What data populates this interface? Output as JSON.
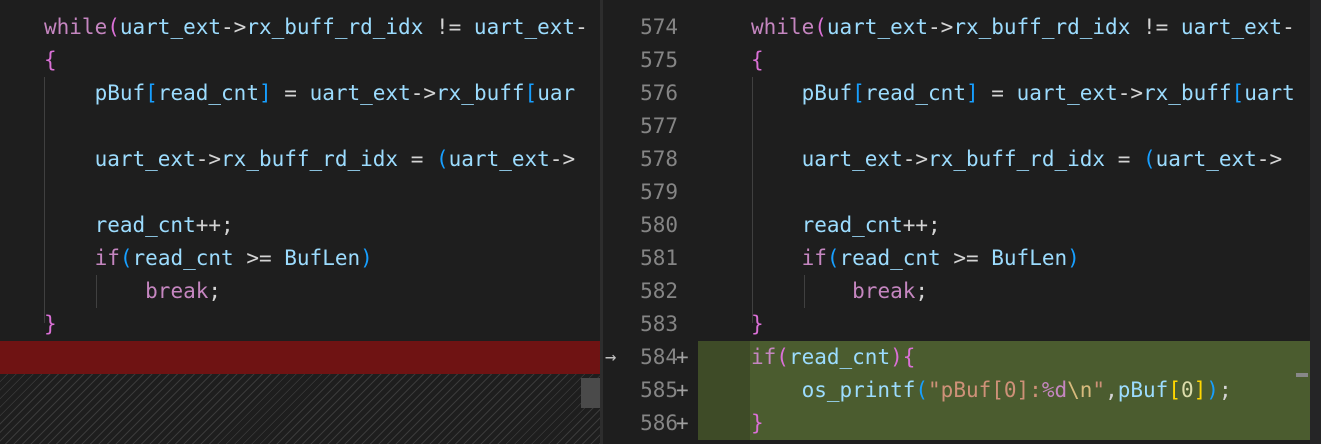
{
  "left": {
    "lines": [
      [
        {
          "t": "while",
          "c": "k"
        },
        {
          "t": "(",
          "c": "b2"
        },
        {
          "t": "uart_ext",
          "c": "v"
        },
        {
          "t": "->",
          "c": "o"
        },
        {
          "t": "rx_buff_rd_idx",
          "c": "v"
        },
        {
          "t": " != ",
          "c": "o"
        },
        {
          "t": "uart_ext",
          "c": "v"
        },
        {
          "t": "-",
          "c": "o"
        }
      ],
      [
        {
          "t": "{",
          "c": "b2"
        }
      ],
      [
        {
          "t": "    ",
          "c": "o"
        },
        {
          "t": "pBuf",
          "c": "v"
        },
        {
          "t": "[",
          "c": "b3"
        },
        {
          "t": "read_cnt",
          "c": "v"
        },
        {
          "t": "]",
          "c": "b3"
        },
        {
          "t": " = ",
          "c": "o"
        },
        {
          "t": "uart_ext",
          "c": "v"
        },
        {
          "t": "->",
          "c": "o"
        },
        {
          "t": "rx_buff",
          "c": "v"
        },
        {
          "t": "[",
          "c": "b3"
        },
        {
          "t": "uar",
          "c": "v"
        }
      ],
      [],
      [
        {
          "t": "    ",
          "c": "o"
        },
        {
          "t": "uart_ext",
          "c": "v"
        },
        {
          "t": "->",
          "c": "o"
        },
        {
          "t": "rx_buff_rd_idx",
          "c": "v"
        },
        {
          "t": " = ",
          "c": "o"
        },
        {
          "t": "(",
          "c": "b3"
        },
        {
          "t": "uart_ext",
          "c": "v"
        },
        {
          "t": "->",
          "c": "o"
        }
      ],
      [],
      [
        {
          "t": "    ",
          "c": "o"
        },
        {
          "t": "read_cnt",
          "c": "v"
        },
        {
          "t": "++;",
          "c": "o"
        }
      ],
      [
        {
          "t": "    ",
          "c": "o"
        },
        {
          "t": "if",
          "c": "k"
        },
        {
          "t": "(",
          "c": "b3"
        },
        {
          "t": "read_cnt",
          "c": "v"
        },
        {
          "t": " >= ",
          "c": "o"
        },
        {
          "t": "BufLen",
          "c": "v"
        },
        {
          "t": ")",
          "c": "b3"
        }
      ],
      [
        {
          "t": "        ",
          "c": "o"
        },
        {
          "t": "break",
          "c": "k"
        },
        {
          "t": ";",
          "c": "o"
        }
      ],
      [
        {
          "t": "}",
          "c": "b2"
        }
      ]
    ]
  },
  "gutter": {
    "line_numbers": [
      "574",
      "575",
      "576",
      "577",
      "578",
      "579",
      "580",
      "581",
      "582",
      "583",
      "584",
      "585",
      "586"
    ],
    "added_marker": "+",
    "arrow": "→"
  },
  "right": {
    "lines": [
      [
        {
          "t": "while",
          "c": "k"
        },
        {
          "t": "(",
          "c": "b2"
        },
        {
          "t": "uart_ext",
          "c": "v"
        },
        {
          "t": "->",
          "c": "o"
        },
        {
          "t": "rx_buff_rd_idx",
          "c": "v"
        },
        {
          "t": " != ",
          "c": "o"
        },
        {
          "t": "uart_ext",
          "c": "v"
        },
        {
          "t": "-",
          "c": "o"
        }
      ],
      [
        {
          "t": "{",
          "c": "b2"
        }
      ],
      [
        {
          "t": "    ",
          "c": "o"
        },
        {
          "t": "pBuf",
          "c": "v"
        },
        {
          "t": "[",
          "c": "b3"
        },
        {
          "t": "read_cnt",
          "c": "v"
        },
        {
          "t": "]",
          "c": "b3"
        },
        {
          "t": " = ",
          "c": "o"
        },
        {
          "t": "uart_ext",
          "c": "v"
        },
        {
          "t": "->",
          "c": "o"
        },
        {
          "t": "rx_buff",
          "c": "v"
        },
        {
          "t": "[",
          "c": "b3"
        },
        {
          "t": "uart",
          "c": "v"
        }
      ],
      [],
      [
        {
          "t": "    ",
          "c": "o"
        },
        {
          "t": "uart_ext",
          "c": "v"
        },
        {
          "t": "->",
          "c": "o"
        },
        {
          "t": "rx_buff_rd_idx",
          "c": "v"
        },
        {
          "t": " = ",
          "c": "o"
        },
        {
          "t": "(",
          "c": "b3"
        },
        {
          "t": "uart_ext",
          "c": "v"
        },
        {
          "t": "->",
          "c": "o"
        }
      ],
      [],
      [
        {
          "t": "    ",
          "c": "o"
        },
        {
          "t": "read_cnt",
          "c": "v"
        },
        {
          "t": "++;",
          "c": "o"
        }
      ],
      [
        {
          "t": "    ",
          "c": "o"
        },
        {
          "t": "if",
          "c": "k"
        },
        {
          "t": "(",
          "c": "b3"
        },
        {
          "t": "read_cnt",
          "c": "v"
        },
        {
          "t": " >= ",
          "c": "o"
        },
        {
          "t": "BufLen",
          "c": "v"
        },
        {
          "t": ")",
          "c": "b3"
        }
      ],
      [
        {
          "t": "        ",
          "c": "o"
        },
        {
          "t": "break",
          "c": "k"
        },
        {
          "t": ";",
          "c": "o"
        }
      ],
      [
        {
          "t": "}",
          "c": "b2"
        }
      ],
      [
        {
          "t": "if",
          "c": "k"
        },
        {
          "t": "(",
          "c": "b2"
        },
        {
          "t": "read_cnt",
          "c": "v"
        },
        {
          "t": ")",
          "c": "b2"
        },
        {
          "t": "{",
          "c": "b2"
        }
      ],
      [
        {
          "t": "    ",
          "c": "o"
        },
        {
          "t": "os_printf",
          "c": "v"
        },
        {
          "t": "(",
          "c": "b3"
        },
        {
          "t": "\"pBuf[0]:",
          "c": "s"
        },
        {
          "t": "%d",
          "c": "ks"
        },
        {
          "t": "\\n",
          "c": "e"
        },
        {
          "t": "\"",
          "c": "s"
        },
        {
          "t": ",",
          "c": "o"
        },
        {
          "t": "pBuf",
          "c": "v"
        },
        {
          "t": "[",
          "c": "b1"
        },
        {
          "t": "0",
          "c": "fn"
        },
        {
          "t": "]",
          "c": "b1"
        },
        {
          "t": ")",
          "c": "b3"
        },
        {
          "t": ";",
          "c": "o"
        }
      ],
      [
        {
          "t": "}",
          "c": "b2"
        }
      ]
    ]
  }
}
